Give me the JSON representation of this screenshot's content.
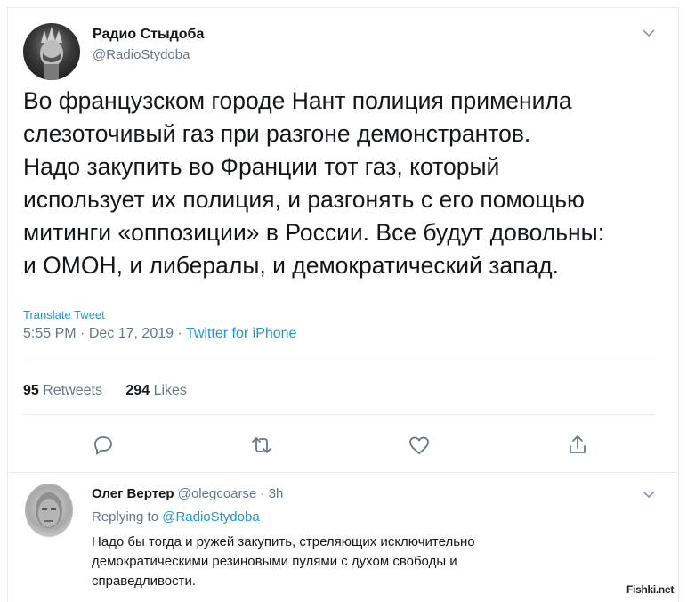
{
  "tweet": {
    "author_name": "Радио Стыдоба",
    "author_handle": "@RadioStydoba",
    "text": "Во французском городе Нант полиция применила\nслезоточивый газ при разгоне демонстрантов.\nНадо закупить во Франции тот газ, который\nиспользует их полиция, и разгонять с его помощью\nмитинги «оппозиции» в России. Все будут довольны:\nи ОМОН, и либералы, и демократический запад.",
    "translate_label": "Translate Tweet",
    "time": "5:55 PM",
    "date": "Dec 17, 2019",
    "source": "Twitter for iPhone",
    "retweets_count": "95",
    "retweets_label": "Retweets",
    "likes_count": "294",
    "likes_label": "Likes"
  },
  "reply": {
    "author_name": "Олег Вертер",
    "author_handle": "@olegcoarse",
    "age": "3h",
    "replying_prefix": "Replying to",
    "replying_to": "@RadioStydoba",
    "text": "Надо бы тогда и ружей закупить, стреляющих исключительно\nдемократическими резиновыми пулями с духом свободы и\nсправедливости."
  },
  "watermark": "Fishki.net",
  "colors": {
    "link": "#1b95e0",
    "secondary": "#657786",
    "text": "#14171a",
    "border": "#e6ecf0"
  },
  "icons": [
    "chevron-down-icon",
    "reply-icon",
    "retweet-icon",
    "like-icon",
    "share-icon"
  ]
}
